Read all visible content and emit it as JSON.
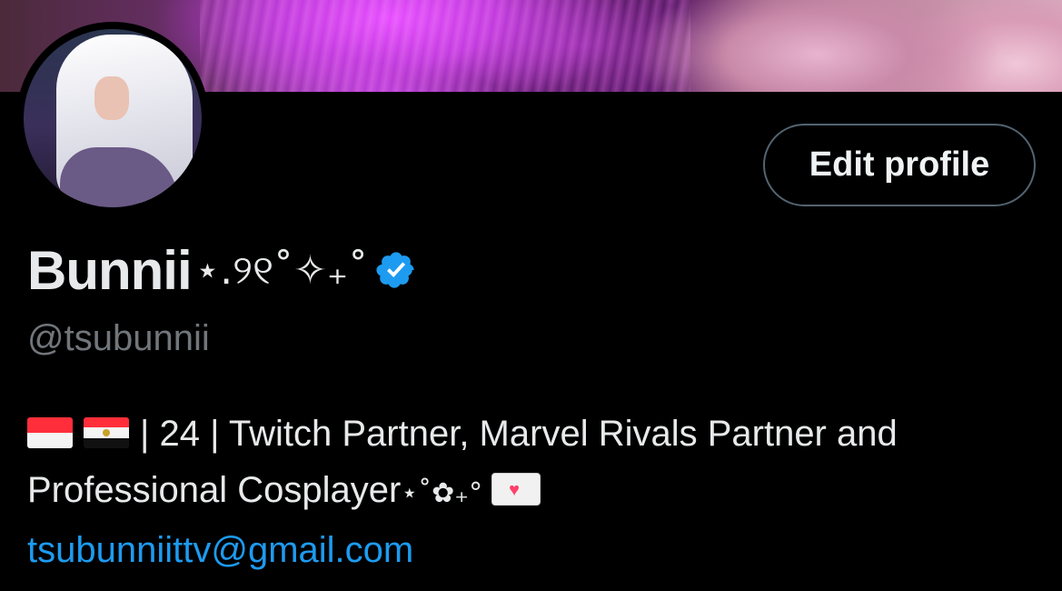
{
  "profile": {
    "display_name": "Bunnii",
    "name_decoration": "⋆.୨୧˚✧₊˚",
    "verified_icon": "verified-badge-icon",
    "handle": "@tsubunnii",
    "edit_button_label": "Edit profile",
    "bio": {
      "flags": [
        "indonesia-flag-icon",
        "egypt-flag-icon"
      ],
      "line1_text": "| 24 | Twitch Partner, Marvel Rivals Partner and",
      "line2_text": "Professional Cosplayer",
      "line2_deco": "⋆˚✿₊°",
      "envelope_icon": "love-letter-icon",
      "email": "tsubunniittv@gmail.com"
    }
  },
  "colors": {
    "background": "#000000",
    "text_primary": "#e7e9ea",
    "text_secondary": "#71767b",
    "link": "#1d9bf0",
    "verified": "#1d9bf0",
    "button_border": "#536471"
  }
}
